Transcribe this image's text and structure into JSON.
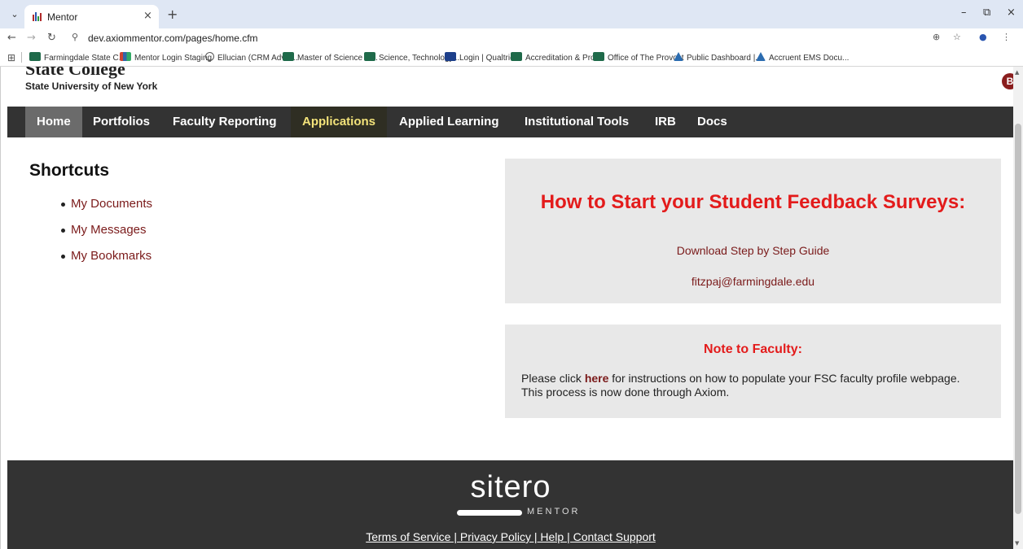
{
  "browser": {
    "tab_title": "Mentor",
    "tab_close": "×",
    "new_tab": "+",
    "url": "dev.axiommentor.com/pages/home.cfm",
    "window_controls": [
      "–",
      "⧉",
      "×"
    ],
    "bookmarks": [
      {
        "label": "Farmingdale State C...",
        "icon": "fsc"
      },
      {
        "label": "Mentor Login Staging",
        "icon": "mentor"
      },
      {
        "label": "Ellucian (CRM Advis...",
        "icon": "globe"
      },
      {
        "label": "Master of Science in...",
        "icon": "fsc"
      },
      {
        "label": "Science, Technology...",
        "icon": "fsc"
      },
      {
        "label": "Login | Qualtrics",
        "icon": "xm"
      },
      {
        "label": "Accreditation & Pro...",
        "icon": "fsc"
      },
      {
        "label": "Office of The Provost",
        "icon": "fsc"
      },
      {
        "label": "Public Dashboard |...",
        "icon": "triangle"
      },
      {
        "label": "Accruent EMS Docu...",
        "icon": "triangle"
      }
    ]
  },
  "header": {
    "college_name": "State College",
    "university": "State University of New York"
  },
  "nav": {
    "items": [
      {
        "label": "Home"
      },
      {
        "label": "Portfolios"
      },
      {
        "label": "Faculty Reporting"
      },
      {
        "label": "Applications"
      },
      {
        "label": "Applied Learning"
      },
      {
        "label": "Institutional Tools"
      },
      {
        "label": "IRB"
      },
      {
        "label": "Docs"
      }
    ]
  },
  "shortcuts": {
    "title": "Shortcuts",
    "items": [
      "My Documents",
      "My Messages",
      "My Bookmarks"
    ]
  },
  "surveys_panel": {
    "title": "How to Start your Student Feedback Surveys:",
    "guide_link": "Download Step by Step Guide",
    "email": "fitzpaj@farmingdale.edu"
  },
  "faculty_panel": {
    "title": "Note to Faculty:",
    "text_before": "Please click ",
    "link": "here",
    "text_after": " for instructions on how to populate your FSC faculty profile webpage. This process is now done through Axiom."
  },
  "footer": {
    "logo": "sitero",
    "logo_sub": "MENTOR",
    "links": "Terms of Service | Privacy Policy | Help | Contact Support"
  },
  "badge": "B"
}
